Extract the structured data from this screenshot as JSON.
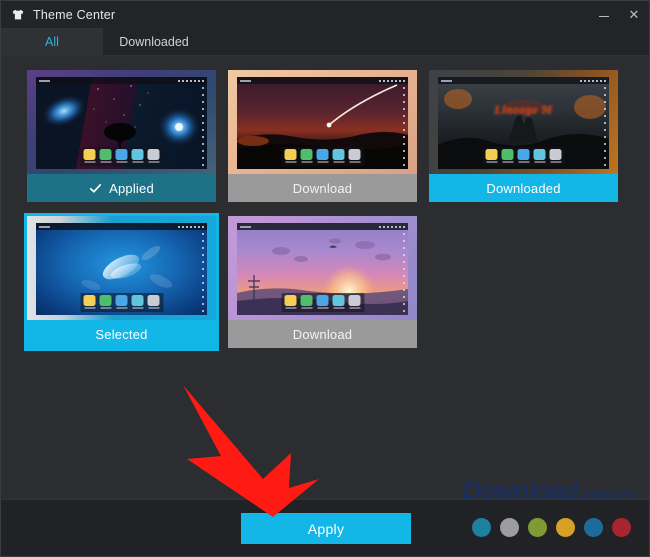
{
  "window": {
    "title": "Theme Center",
    "icon": "tshirt-icon",
    "minimize_label": "–",
    "close_label": "✕"
  },
  "tabs": [
    {
      "label": "All",
      "active": true
    },
    {
      "label": "Downloaded",
      "active": false
    }
  ],
  "themes": [
    {
      "name": "galaxy-tree-theme",
      "status_label": "Applied",
      "state": "applied",
      "has_check": true,
      "selected": false
    },
    {
      "name": "comet-sunset-theme",
      "status_label": "Download",
      "state": "download",
      "has_check": false,
      "selected": false
    },
    {
      "name": "lineage-m-theme",
      "status_label": "Downloaded",
      "state": "downloaded",
      "has_check": false,
      "selected": false
    },
    {
      "name": "blue-aurora-theme",
      "status_label": "Selected",
      "state": "selected",
      "has_check": false,
      "selected": true
    },
    {
      "name": "purple-sunrise-theme",
      "status_label": "Download",
      "state": "download",
      "has_check": false,
      "selected": false
    }
  ],
  "footer": {
    "apply_label": "Apply",
    "color_swatches": [
      {
        "name": "teal",
        "hex": "#1e7fa0"
      },
      {
        "name": "gray",
        "hex": "#9d9d9d"
      },
      {
        "name": "olive-green",
        "hex": "#7f9b34"
      },
      {
        "name": "amber",
        "hex": "#d8a126"
      },
      {
        "name": "blue",
        "hex": "#1d6b9c"
      },
      {
        "name": "red",
        "hex": "#a8252f"
      }
    ]
  },
  "watermark": {
    "main": "Download",
    "suffix": ".com.vn"
  },
  "colors": {
    "accent": "#12b7e8",
    "applied_bar": "#1d7287",
    "download_bar": "#9a9a9a",
    "window_bg": "#2b2d31",
    "titlebar_bg": "#232427",
    "annotation_arrow": "#ff1a13"
  }
}
